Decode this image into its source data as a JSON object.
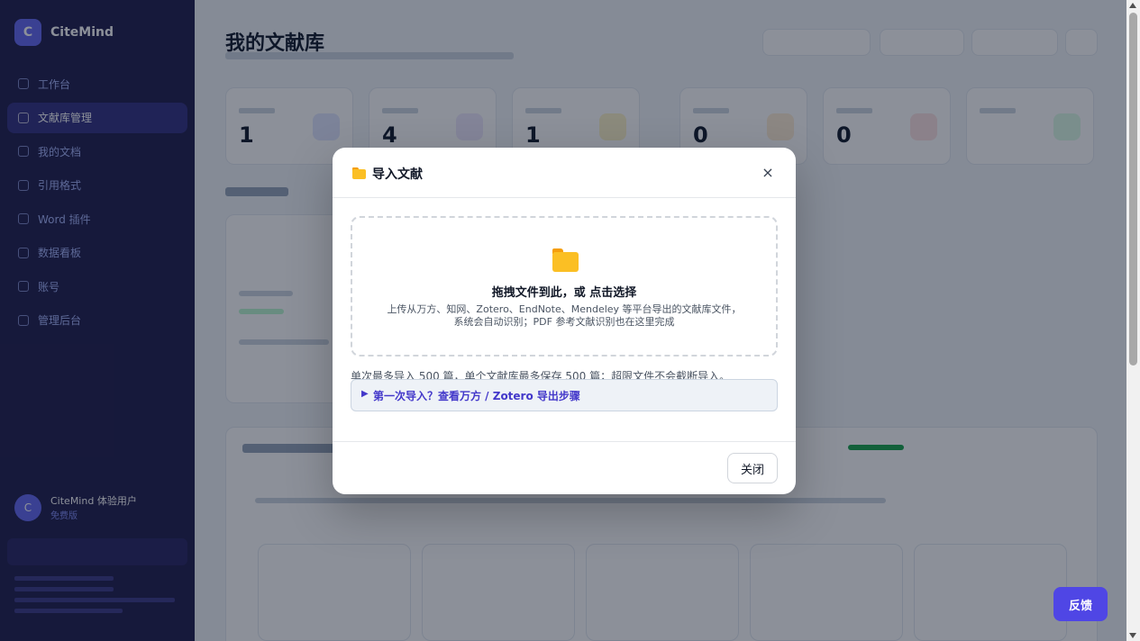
{
  "sidebar": {
    "brand": "CiteMind",
    "logo_letter": "C",
    "items": [
      {
        "label": "工作台",
        "active": false
      },
      {
        "label": "文献库管理",
        "active": true
      },
      {
        "label": "我的文档",
        "active": false
      },
      {
        "label": "引用格式",
        "active": false
      },
      {
        "label": "Word 插件",
        "active": false
      },
      {
        "label": "数据看板",
        "active": false
      },
      {
        "label": "账号",
        "active": false
      },
      {
        "label": "管理后台",
        "active": false
      }
    ],
    "user_name": "CiteMind 体验用户",
    "user_sub": "免费版",
    "avatar_letter": "C"
  },
  "main": {
    "title": "我的文献库",
    "stats": [
      {
        "value": "1"
      },
      {
        "value": "4"
      },
      {
        "value": "1"
      },
      {
        "value": "0"
      },
      {
        "value": "0"
      },
      {
        "value": ""
      }
    ]
  },
  "modal": {
    "title": "导入文献",
    "close_symbol": "×",
    "dropzone_title": "拖拽文件到此，或 点击选择",
    "dropzone_desc_line1": "上传从万方、知网、Zotero、EndNote、Mendeley 等平台导出的文献库文件，",
    "dropzone_desc_line2": "系统会自动识别；PDF 参考文献识别也在这里完成",
    "limit_note": "单次最多导入 500 篇，单个文献库最多保存 500 篇；超限文件不会截断导入。",
    "details_caret": "▶",
    "details_label": "第一次导入？查看万方 / Zotero 导出步骤",
    "close_button": "关闭"
  },
  "feedback_button": "反馈",
  "colors": {
    "accent": "#4f46e5",
    "sidebar_bg": "#1e1b4b",
    "folder": "#fbbf24"
  },
  "icons": [
    "folder-icon",
    "close-icon",
    "caret-right-icon"
  ]
}
